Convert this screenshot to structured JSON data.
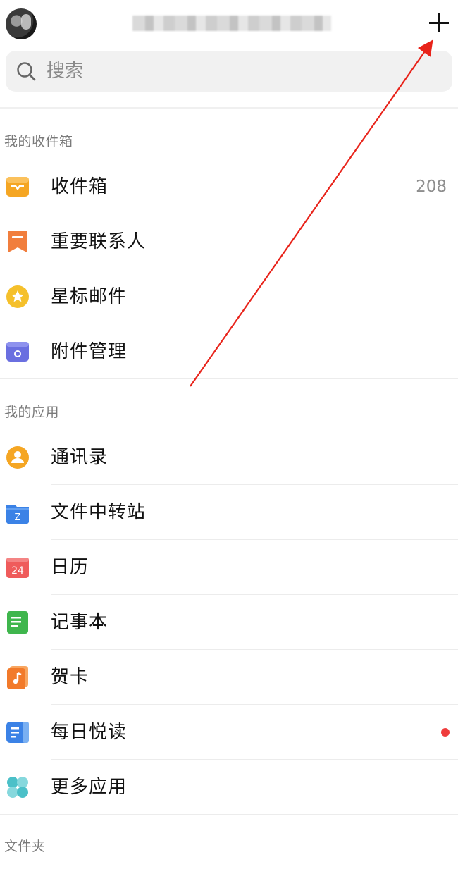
{
  "header": {
    "avatar_icon": "avatar-icon",
    "add_icon": "plus-icon"
  },
  "search": {
    "placeholder": "搜索",
    "icon": "search-icon"
  },
  "sections": {
    "inbox_title": "我的收件箱",
    "apps_title": "我的应用",
    "folders_title": "文件夹"
  },
  "inbox_items": [
    {
      "label": "收件箱",
      "count": "208",
      "icon": "inbox-tray-icon",
      "color": "#f5a623"
    },
    {
      "label": "重要联系人",
      "icon": "bookmark-icon",
      "color": "#f17e3d"
    },
    {
      "label": "星标邮件",
      "icon": "star-icon",
      "color": "#f5c02b"
    },
    {
      "label": "附件管理",
      "icon": "attachment-box-icon",
      "color": "#6a6fe0"
    }
  ],
  "app_items": [
    {
      "label": "通讯录",
      "icon": "contacts-icon",
      "color": "#f5a623"
    },
    {
      "label": "文件中转站",
      "icon": "folder-z-icon",
      "color": "#3b82e6"
    },
    {
      "label": "日历",
      "icon": "calendar-icon",
      "badge": "24",
      "color": "#ef5b5b"
    },
    {
      "label": "记事本",
      "icon": "notepad-icon",
      "color": "#3fb64d"
    },
    {
      "label": "贺卡",
      "icon": "music-card-icon",
      "color": "#f27a2a"
    },
    {
      "label": "每日悦读",
      "icon": "reading-icon",
      "color": "#3b82e6",
      "unread_dot": true
    },
    {
      "label": "更多应用",
      "icon": "more-apps-icon",
      "color": "#4bc0c8"
    }
  ],
  "annotation": {
    "arrow_color": "#e8231a"
  }
}
